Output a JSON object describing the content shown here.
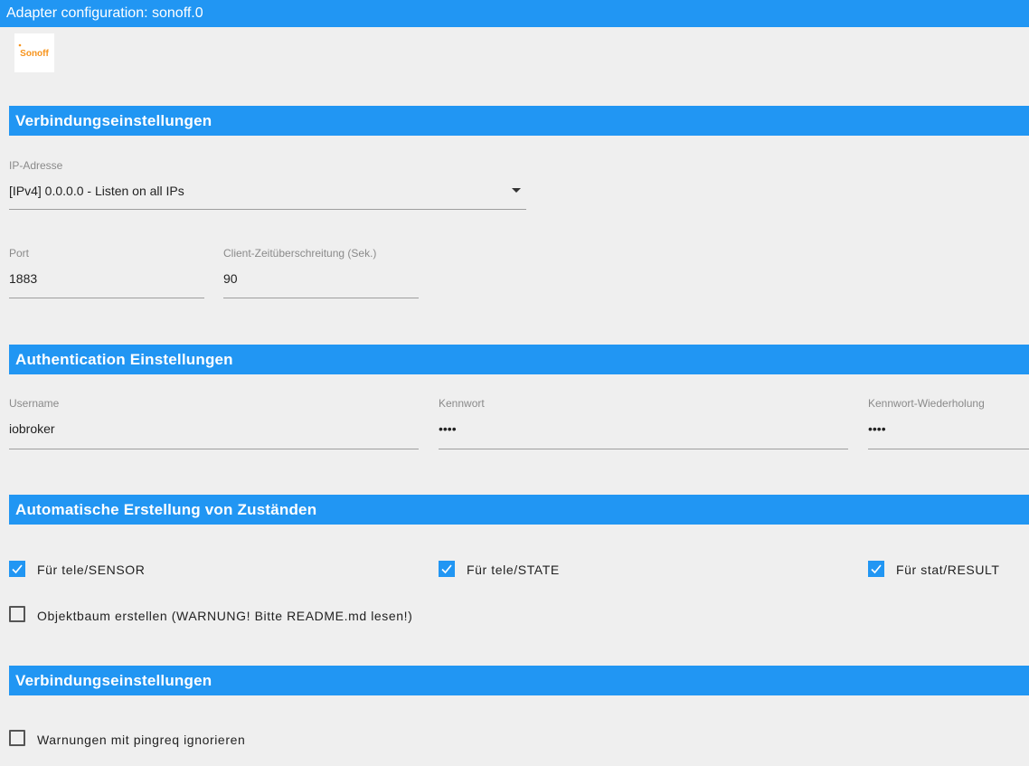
{
  "window": {
    "title": "Adapter configuration: sonoff.0"
  },
  "logo": {
    "text": "Sonoff",
    "icon": "sonoff-logo",
    "color": "#f7941d"
  },
  "sections": {
    "connection": "Verbindungseinstellungen",
    "auth": "Authentication Einstellungen",
    "auto": "Automatische Erstellung von Zuständen",
    "connection2": "Verbindungseinstellungen"
  },
  "ip": {
    "label": "IP-Adresse",
    "value": "[IPv4] 0.0.0.0 - Listen on all IPs"
  },
  "port": {
    "label": "Port",
    "value": "1883"
  },
  "timeout": {
    "label": "Client-Zeitüberschreitung (Sek.)",
    "value": "90"
  },
  "username": {
    "label": "Username",
    "value": "iobroker"
  },
  "password": {
    "label": "Kennwort",
    "value": "••••"
  },
  "password2": {
    "label": "Kennwort-Wiederholung",
    "value": "••••"
  },
  "checkboxes": {
    "tele_sensor": {
      "label": "Für tele/SENSOR",
      "checked": true
    },
    "tele_state": {
      "label": "Für tele/STATE",
      "checked": true
    },
    "stat_result": {
      "label": "Für stat/RESULT",
      "checked": true
    },
    "object_tree": {
      "label": "Objektbaum erstellen (WARNUNG! Bitte README.md lesen!)",
      "checked": false
    },
    "pingreq": {
      "label": "Warnungen mit pingreq ignorieren",
      "checked": false
    }
  },
  "colors": {
    "accent": "#2196f3",
    "background": "#efefef"
  }
}
